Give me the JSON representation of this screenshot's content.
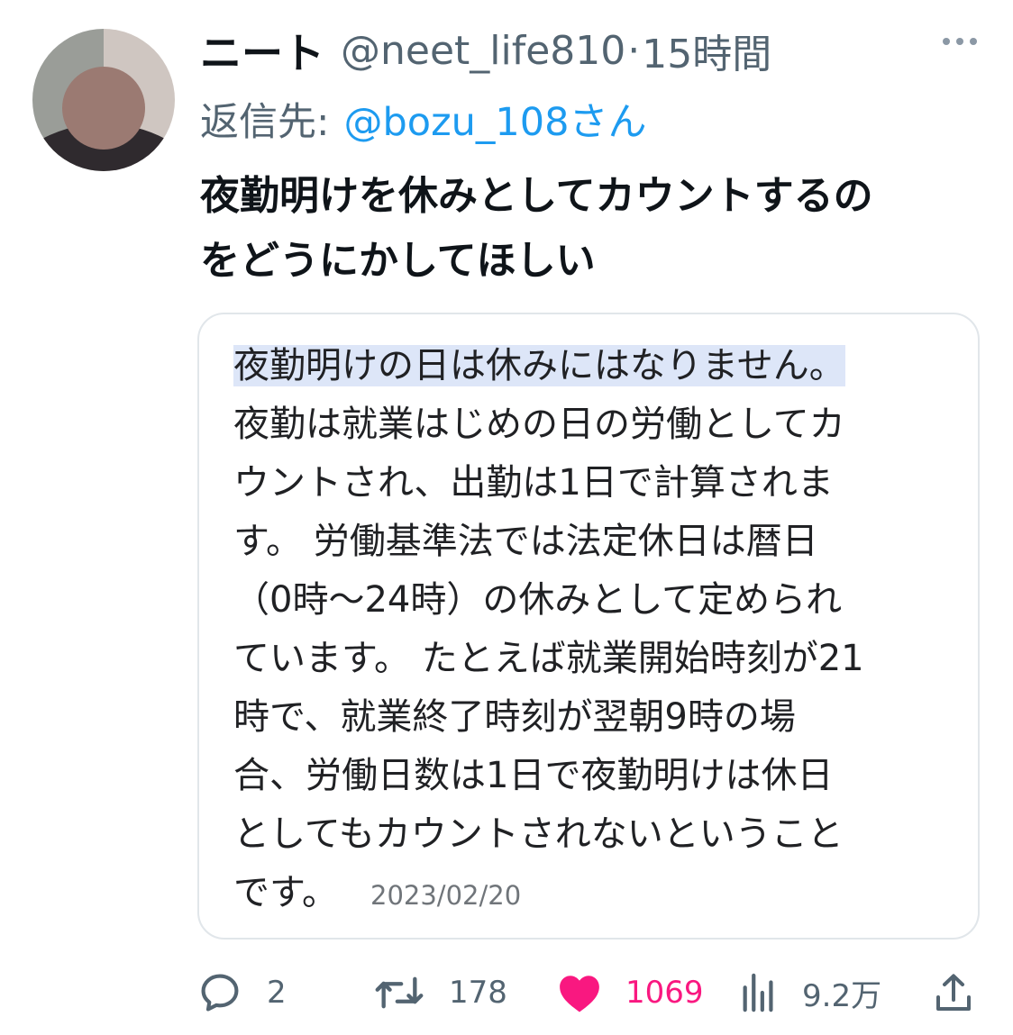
{
  "author": {
    "display_name": "ニート",
    "handle": "@neet_life810",
    "separator": "·",
    "time_ago": "15時間"
  },
  "reply": {
    "prefix": "返信先:",
    "handle": "@bozu_108さん"
  },
  "tweet": {
    "lines": [
      "夜勤明けを休みとしてカウントするの",
      "をどうにかしてほしい"
    ]
  },
  "quote": {
    "highlighted_line": "夜勤明けの日は休みにはなりません。",
    "lines": [
      "夜勤は就業はじめの日の労働としてカ",
      "ウントされ、出勤は1日で計算されま",
      "す。 労働基準法では法定休日は暦日",
      "（0時～24時）の休みとして定められ",
      "ています。 たとえば就業開始時刻が21",
      "時で、就業終了時刻が翌朝9時の場",
      "合、労働日数は1日で夜勤明けは休日",
      "としてもカウントされないということ"
    ],
    "last_line": "です。",
    "date": "2023/02/20"
  },
  "actions": {
    "replies": "2",
    "retweets": "178",
    "likes": "1069",
    "views": "9.2万"
  },
  "colors": {
    "like": "#f91880",
    "link": "#1d9bf0",
    "muted": "#536471"
  }
}
